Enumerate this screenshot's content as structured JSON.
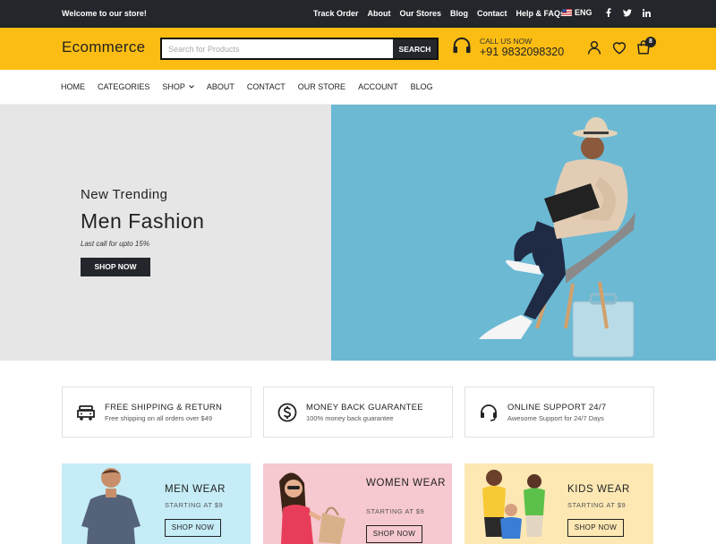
{
  "topbar": {
    "welcome": "Welcome to our store!",
    "links": [
      "Track Order",
      "About",
      "Our Stores",
      "Blog",
      "Contact",
      "Help & FAQs"
    ],
    "language": "ENG",
    "social_icons": [
      "facebook-icon",
      "twitter-icon",
      "linkedin-icon"
    ]
  },
  "header": {
    "logo": "Ecommerce",
    "search_placeholder": "Search for Products",
    "search_button": "SEARCH",
    "call_label": "CALL US NOW",
    "call_number": "+91 9832098320",
    "cart_count": "8",
    "accent_color": "#fbbd13"
  },
  "nav": {
    "items": [
      "HOME",
      "CATEGORIES",
      "SHOP",
      "ABOUT",
      "CONTACT",
      "OUR STORE",
      "ACCOUNT",
      "BLOG"
    ]
  },
  "hero": {
    "subtitle": "New Trending",
    "title": "Men Fashion",
    "caption": "Last call for upto 15%",
    "button": "SHOP NOW"
  },
  "features": [
    {
      "title": "FREE SHIPPING & RETURN",
      "subtitle": "Free shipping on all orders over $49",
      "icon": "truck-icon"
    },
    {
      "title": "MONEY BACK GUARANTEE",
      "subtitle": "100% money back guarantee",
      "icon": "dollar-icon"
    },
    {
      "title": "ONLINE SUPPORT 24/7",
      "subtitle": "Awesome Support for 24/7 Days",
      "icon": "headset-icon"
    }
  ],
  "categories": [
    {
      "title": "MEN WEAR",
      "subtitle": "STARTING AT $9",
      "button": "SHOP NOW",
      "bg": "#c5ecf7"
    },
    {
      "title": "WOMEN WEAR",
      "subtitle": "STARTING AT $9",
      "button": "SHOP NOW",
      "bg": "#f6c8cf"
    },
    {
      "title": "KIDS WEAR",
      "subtitle": "STARTING AT $9",
      "button": "SHOP NOW",
      "bg": "#fde8b4"
    }
  ]
}
